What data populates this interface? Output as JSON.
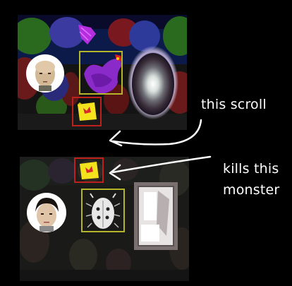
{
  "annotations": {
    "caption_top": "this scroll",
    "caption_bottom_line1": "kills this",
    "caption_bottom_line2": "monster"
  },
  "scene_top": {
    "hero": "bald-hero-portrait",
    "scroll": "scroll-icon",
    "monster": "purple-bird-monster",
    "portal": "portal-orb",
    "selection_color": "#b5b52c",
    "scroll_frame_color": "#c0201b"
  },
  "scene_bottom": {
    "hero": "dark-haired-hero-portrait",
    "scroll": "scroll-icon",
    "monster": "beetle-monster",
    "door": "stone-door",
    "selection_color": "#b5b52c",
    "scroll_frame_color": "#c0201b"
  },
  "colors": {
    "background": "#000000",
    "caption_text": "#ffffff",
    "scroll_yellow": "#f4e21c",
    "scroll_red": "#d8282a"
  }
}
